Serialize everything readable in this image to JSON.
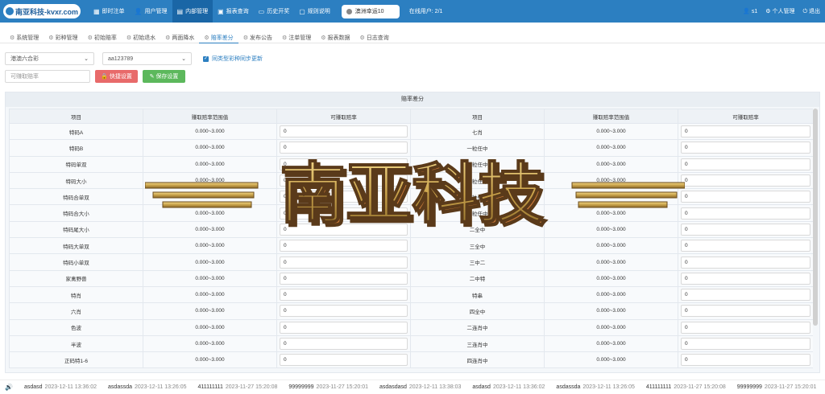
{
  "header": {
    "logo_text": "南亚科技-kvxr.com",
    "nav": [
      {
        "icon": "▦",
        "label": "即时注单"
      },
      {
        "icon": "👤",
        "label": "用户管理"
      },
      {
        "icon": "▤",
        "label": "内部管理"
      },
      {
        "icon": "▣",
        "label": "报表查询"
      },
      {
        "icon": "▭",
        "label": "历史开奖"
      },
      {
        "icon": "▢",
        "label": "规则说明"
      }
    ],
    "lottery": "澳洲幸运10",
    "online_users": "在线用户: 2/1",
    "user": "s1",
    "personal": "个人管理",
    "logout": "退出"
  },
  "subtabs": [
    "系统管理",
    "彩种管理",
    "初始赔率",
    "初始退水",
    "两面降水",
    "赔率差分",
    "发布公告",
    "注单管理",
    "报表数据",
    "日志查询"
  ],
  "filters": {
    "game": "港澳六合彩",
    "account": "aa123789",
    "sync_label": "同类型彩种同步更新"
  },
  "actions": {
    "placeholder": "可赚取赔率",
    "quick_label": "快捷设置",
    "save_label": "保存设置"
  },
  "table": {
    "title": "赔率差分",
    "headers": [
      "项目",
      "赚取赔率范围值",
      "可赚取赔率",
      "项目",
      "赚取赔率范围值",
      "可赚取赔率"
    ],
    "rows": [
      [
        "特码A",
        "0.000~3.000",
        "0",
        "七肖",
        "0.000~3.000",
        "0"
      ],
      [
        "特码B",
        "0.000~3.000",
        "0",
        "一粒任中",
        "0.000~3.000",
        "0"
      ],
      [
        "特码单双",
        "0.000~3.000",
        "0",
        "二粒任中",
        "0.000~3.000",
        "0"
      ],
      [
        "特码大小",
        "0.000~3.000",
        "0",
        "三粒任中",
        "0.000~3.000",
        "0"
      ],
      [
        "特码合单双",
        "0.000~2.000",
        "0",
        "四粒任中",
        "0.000~3.000",
        "0"
      ],
      [
        "特码合大小",
        "0.000~3.000",
        "0",
        "五粒任中",
        "0.000~3.000",
        "0"
      ],
      [
        "特码尾大小",
        "0.000~3.000",
        "0",
        "二全中",
        "0.000~3.000",
        "0"
      ],
      [
        "特码大单双",
        "0.000~3.000",
        "0",
        "三全中",
        "0.000~3.000",
        "0"
      ],
      [
        "特码小单双",
        "0.000~3.000",
        "0",
        "三中二",
        "0.000~3.000",
        "0"
      ],
      [
        "家禽野兽",
        "0.000~3.000",
        "0",
        "二中特",
        "0.000~3.000",
        "0"
      ],
      [
        "特肖",
        "0.000~3.000",
        "0",
        "特串",
        "0.000~3.000",
        "0"
      ],
      [
        "六肖",
        "0.000~3.000",
        "0",
        "四全中",
        "0.000~3.000",
        "0"
      ],
      [
        "色波",
        "0.000~3.000",
        "0",
        "二连肖中",
        "0.000~3.000",
        "0"
      ],
      [
        "半波",
        "0.000~3.000",
        "0",
        "三连肖中",
        "0.000~3.000",
        "0"
      ],
      [
        "正码特1-6",
        "0.000~3.000",
        "0",
        "四连肖中",
        "0.000~3.000",
        "0"
      ]
    ]
  },
  "watermark": "南亚科技",
  "ticker": [
    {
      "name": "asdasd",
      "time": "2023-12-11 13:36:02"
    },
    {
      "name": "asdassda",
      "time": "2023-12-11 13:26:05"
    },
    {
      "name": "411111111",
      "time": "2023-11-27 15:20:08"
    },
    {
      "name": "99999999",
      "time": "2023-11-27 15:20:01"
    },
    {
      "name": "asdasdasd",
      "time": "2023-12-11 13:38:03"
    },
    {
      "name": "asdasd",
      "time": "2023-12-11 13:36:02"
    },
    {
      "name": "asdassda",
      "time": "2023-12-11 13:26:05"
    },
    {
      "name": "411111111",
      "time": "2023-11-27 15:20:08"
    },
    {
      "name": "99999999",
      "time": "2023-11-27 15:20:01"
    }
  ]
}
